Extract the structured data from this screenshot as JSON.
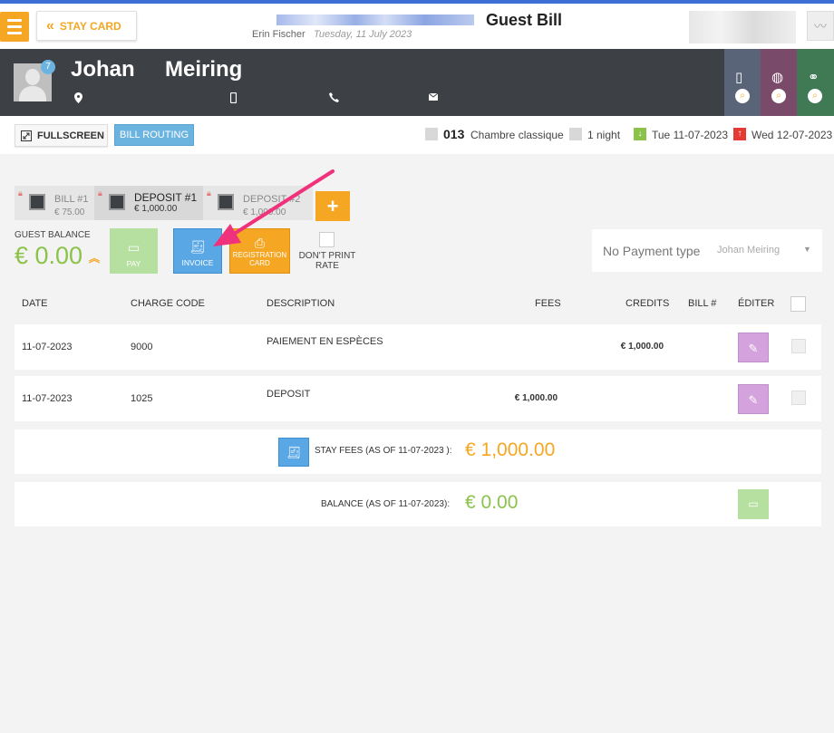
{
  "header": {
    "stay_card_label": "STAY CARD",
    "title": "Guest Bill",
    "user": "Erin Fischer",
    "date": "Tuesday, 11 July 2023"
  },
  "guest": {
    "first_name": "Johan",
    "last_name": "Meiring",
    "badge_count": "7"
  },
  "toolbar": {
    "fullscreen_label": "FULLSCREEN",
    "bill_routing_label": "BILL ROUTING",
    "room_number": "013",
    "room_type": "Chambre classique",
    "nights": "1 night",
    "arrival": "Tue 11-07-2023",
    "departure": "Wed 12-07-2023"
  },
  "bills": [
    {
      "name": "BILL #1",
      "amount": "€ 75.00"
    },
    {
      "name": "DEPOSIT #1",
      "amount": "€ 1,000.00"
    },
    {
      "name": "DEPOSIT #2",
      "amount": "€ 1,000.00"
    }
  ],
  "add_bill_label": "+",
  "balance": {
    "label": "GUEST BALANCE",
    "value": "€ 0.00"
  },
  "actions": {
    "pay_label": "PAY",
    "invoice_label": "INVOICE",
    "registration_card_line1": "REGISTRATION",
    "registration_card_line2": "CARD",
    "dont_print_rate_line1": "DON'T PRINT",
    "dont_print_rate_line2": "RATE"
  },
  "payment": {
    "type_label": "No Payment type",
    "guest_name": "Johan Meiring"
  },
  "table": {
    "headers": [
      "DATE",
      "CHARGE CODE",
      "DESCRIPTION",
      "FEES",
      "CREDITS",
      "BILL #",
      "ÉDITER"
    ],
    "rows": [
      {
        "date": "11-07-2023",
        "charge_code": "9000",
        "description": "PAIEMENT EN ESPÈCES",
        "fees": "",
        "credits": "€ 1,000.00"
      },
      {
        "date": "11-07-2023",
        "charge_code": "1025",
        "description": "DEPOSIT",
        "fees": "€ 1,000.00",
        "credits": ""
      }
    ]
  },
  "summary": {
    "stay_fees_label": "STAY FEES (AS OF  11-07-2023 ):",
    "stay_fees_value": "€ 1,000.00",
    "balance_label": "BALANCE (AS OF  11-07-2023):",
    "balance_value": "€ 0.00"
  },
  "colors": {
    "accent_orange": "#f5a623",
    "balance_green": "#8bc34a",
    "invoice_blue": "#5aa7e6",
    "annotation_pink": "#f0317b",
    "dark_band": "#3d4045"
  }
}
